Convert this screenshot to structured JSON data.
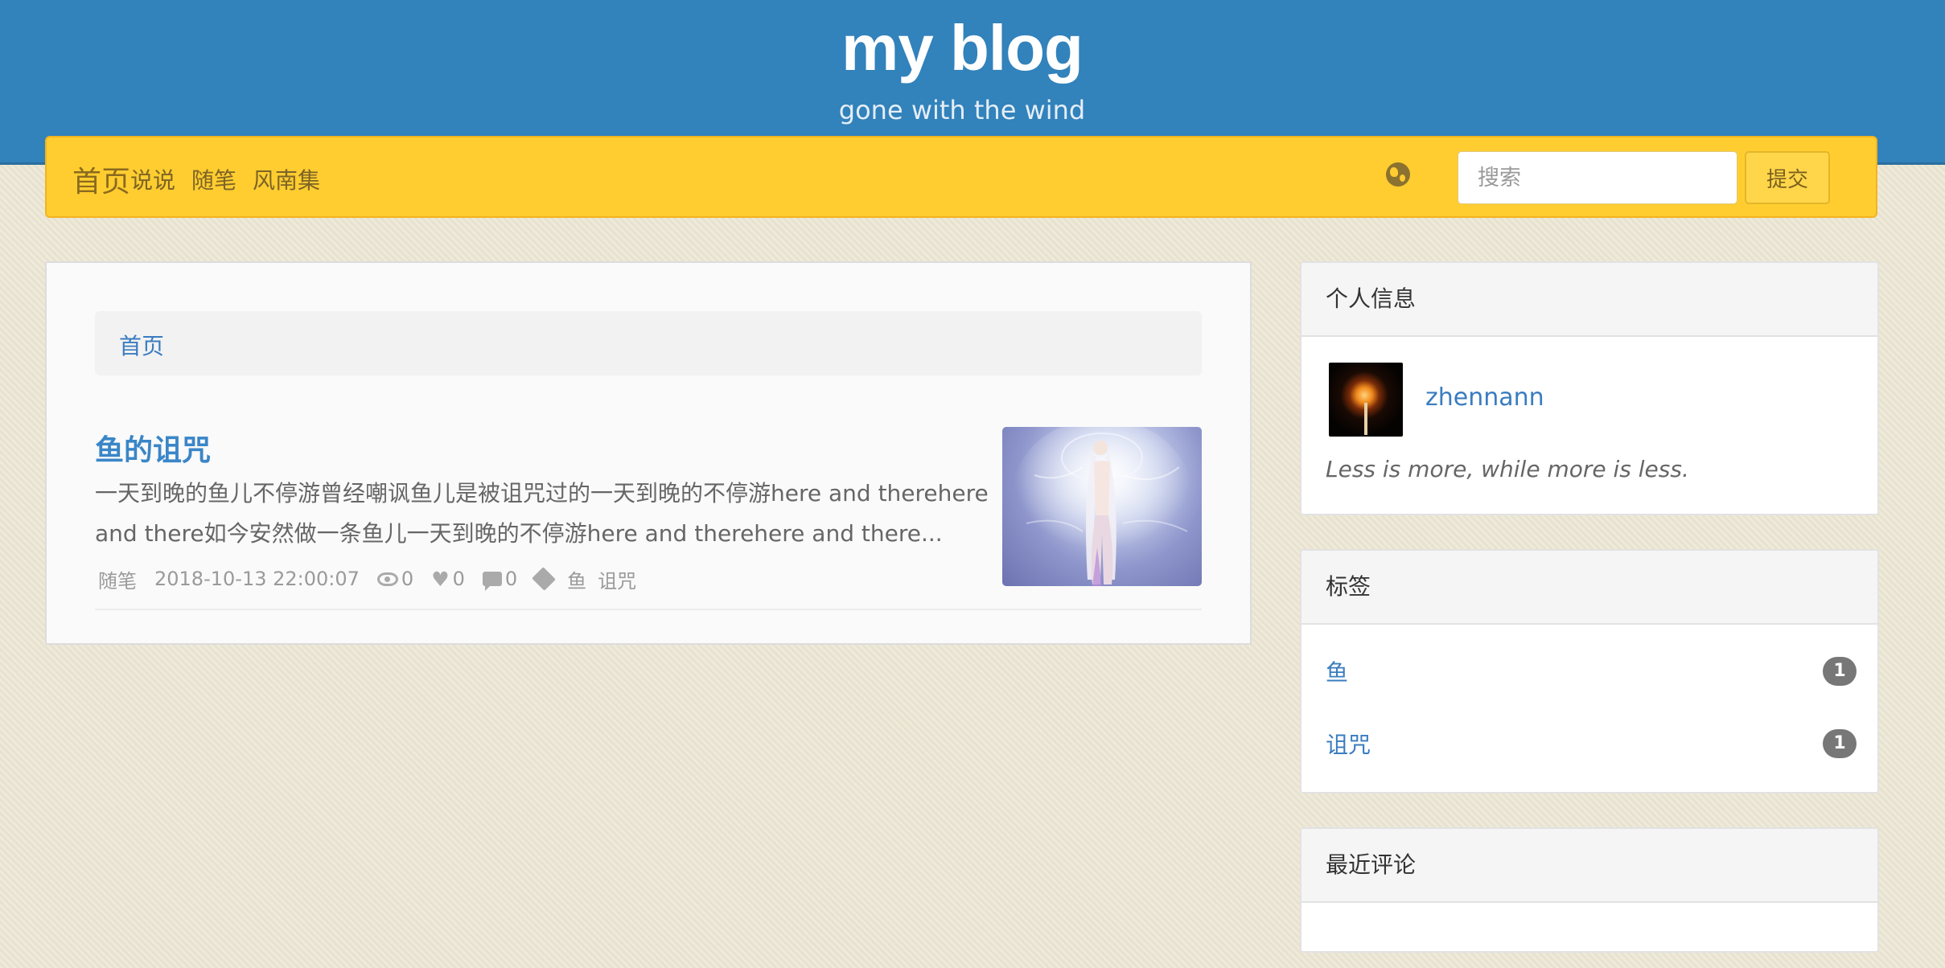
{
  "header": {
    "title": "my blog",
    "subtitle": "gone with the wind"
  },
  "nav": {
    "brand": "首页",
    "items": [
      "说说",
      "随笔",
      "风南集"
    ],
    "globe_icon": "globe-icon",
    "search_placeholder": "搜索",
    "search_button": "提交"
  },
  "breadcrumb": {
    "home": "首页"
  },
  "post": {
    "title": "鱼的诅咒",
    "excerpt": "一天到晚的鱼儿不停游曾经嘲讽鱼儿是被诅咒过的一天到晚的不停游here and therehere and there如今安然做一条鱼儿一天到晚的不停游here and therehere and there...",
    "category": "随笔",
    "date": "2018-10-13 22:00:07",
    "views": "0",
    "likes": "0",
    "comments": "0",
    "tags": [
      "鱼",
      "诅咒"
    ]
  },
  "profile": {
    "title": "个人信息",
    "username": "zhennann",
    "motto": "Less is more, while more is less."
  },
  "tags_widget": {
    "title": "标签",
    "items": [
      {
        "name": "鱼",
        "count": "1"
      },
      {
        "name": "诅咒",
        "count": "1"
      }
    ]
  },
  "recent_comments": {
    "title": "最近评论"
  },
  "colors": {
    "banner": "#3282bb",
    "navbar": "#ffcd30",
    "link": "#3a7cc0"
  }
}
